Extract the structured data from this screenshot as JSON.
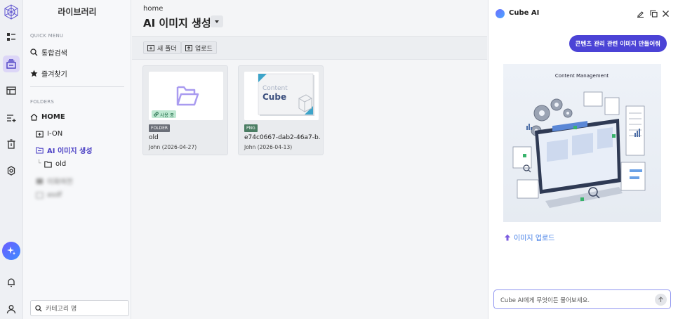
{
  "sidebar": {
    "title": "라이브러리",
    "quick_menu_label": "QUICK MENU",
    "quick_items": [
      {
        "label": "통합검색",
        "icon": "search-icon"
      },
      {
        "label": "즐겨찾기",
        "icon": "star-icon"
      }
    ],
    "folders_label": "FOLDERS",
    "home_label": "HOME",
    "folders": [
      {
        "label": "I-ON"
      },
      {
        "label": "AI 이미지 생성",
        "active": true
      },
      {
        "label": "old",
        "child": true
      },
      {
        "label": "이화여전"
      },
      {
        "label": "asdf"
      }
    ],
    "search_placeholder": "카테고리 명"
  },
  "main": {
    "breadcrumb": "home",
    "title": "AI 이미지 생성",
    "toolbar": {
      "new_folder": "새 폴더",
      "upload": "업로드"
    },
    "cards": [
      {
        "badge": "FOLDER",
        "name": "old",
        "owner": "John",
        "date": "(2026-04-27)",
        "status": "사용 중"
      },
      {
        "badge": "PNG",
        "name": "e74c0667-dab2-46a7-b…",
        "owner": "John",
        "date": "(2026-04-13)",
        "thumb_text_1": "Content",
        "thumb_text_2": "Cube"
      }
    ]
  },
  "chat": {
    "title": "Cube AI",
    "user_message": "콘텐츠 관리 관련 이미지 만들어줘",
    "image_caption": "Content Management",
    "upload_link": "이미지 업로드",
    "input_placeholder": "Cube AI에게 무엇이든 물어보세요."
  },
  "colors": {
    "accent": "#4b43d6",
    "active_rail": "#dcd6f7",
    "link": "#3f7be6",
    "inuse": "#bfe8d2"
  }
}
